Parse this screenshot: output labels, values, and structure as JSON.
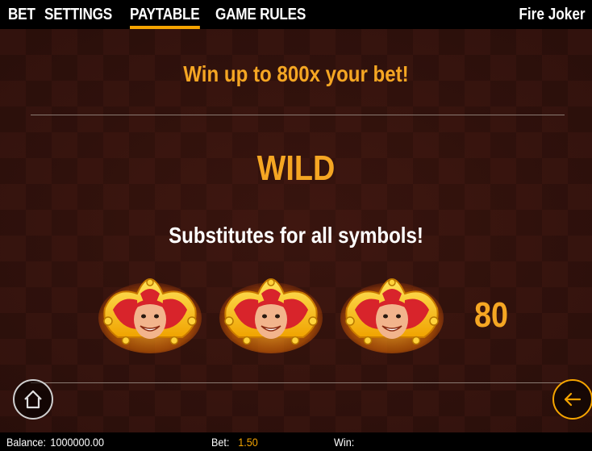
{
  "nav": {
    "tabs": [
      {
        "label": "BET",
        "active": false
      },
      {
        "label": "SETTINGS",
        "active": false
      },
      {
        "label": "PAYTABLE",
        "active": true
      },
      {
        "label": "GAME RULES",
        "active": false
      }
    ],
    "game_title": "Fire Joker"
  },
  "paytable": {
    "headline": "Win up to 800x your bet!",
    "section_title": "WILD",
    "section_description": "Substitutes for all symbols!",
    "symbol_icon": "joker-wild-icon",
    "symbol_count": 3,
    "payout": "80"
  },
  "buttons": {
    "home_icon": "home-icon",
    "back_icon": "arrow-left-icon"
  },
  "status": {
    "balance_label": "Balance:",
    "balance_value": "1000000.00",
    "bet_label": "Bet:",
    "bet_value": "1.50",
    "win_label": "Win:",
    "win_value": ""
  },
  "colors": {
    "accent": "#f5a400",
    "headline": "#f5a623",
    "background": "#3a150f",
    "bar": "#000000"
  }
}
